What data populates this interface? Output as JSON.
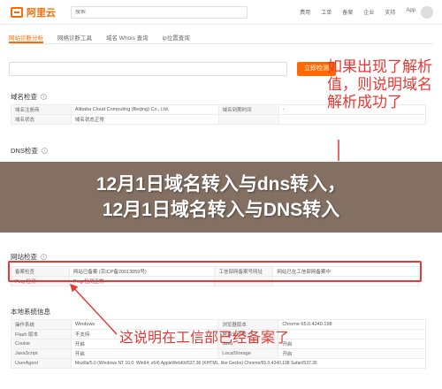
{
  "header": {
    "logo": "阿里云",
    "search_placeholder": "搜索",
    "links": [
      "费用",
      "工单",
      "备案",
      "企业",
      "支持",
      "App"
    ]
  },
  "tabs": [
    "网站诊断分析",
    "网络诊断工具",
    "域名 Whois 查询",
    "ip位置查询"
  ],
  "query": {
    "input_value": "",
    "button": "立即检测"
  },
  "domain_check": {
    "title": "域名检查",
    "rows": [
      {
        "k1": "域名注册商",
        "v1": "Alibaba Cloud Computing (Beijing) Co., Ltd.",
        "k2": "域名到期时间",
        "v2": "-"
      },
      {
        "k1": "域名状态",
        "v1": "域名状态正常",
        "k2": "",
        "v2": ""
      }
    ]
  },
  "dns_check": {
    "title": "DNS检查"
  },
  "banner": {
    "line1": "12月1日域名转入与dns转入，",
    "line2": "12月1日域名转入与DNS转入"
  },
  "site_check": {
    "title": "网站检查",
    "rows": [
      {
        "k1": "备案检查",
        "v1": "网站已备案 (京ICP备20013059号)",
        "k2": "工信部网备案号网址",
        "v2": "网站已在工信部网备案中"
      },
      {
        "k1": "Ping 检测",
        "v1": "Ping 检测正常",
        "k2": "",
        "v2": ""
      }
    ]
  },
  "local_info": {
    "title": "本地系统信息",
    "rows": [
      {
        "k1": "操作系统",
        "v1": "Windows",
        "k2": "浏览器版本",
        "v2": "Chrome 65.0.4240.198"
      },
      {
        "k1": "Flash 版本",
        "v1": "不支持",
        "k2": "屏幕分辨率",
        "v2": "-"
      },
      {
        "k1": "Cookie",
        "v1": "开启",
        "k2": "Java",
        "v2": "开启"
      },
      {
        "k1": "JavaScript",
        "v1": "开启",
        "k2": "LocalStorage",
        "v2": "开启"
      },
      {
        "k1": "UserAgent",
        "v1": "Mozilla/5.0 (Windows NT 10.0; Win64; x64) AppleWebKit/537.36 (KHTML, like Gecko) Chrome/65.0.4240.198 Safari/537.36",
        "k2": "",
        "v2": ""
      }
    ]
  },
  "annotations": {
    "right": "如果出现了解析值，则说明域名解析成功了",
    "bottom": "这说明在工信部已经备案了"
  },
  "colors": {
    "accent": "#ff6a00",
    "annotation_red": "#e53935",
    "ok_green": "#4caf50"
  }
}
